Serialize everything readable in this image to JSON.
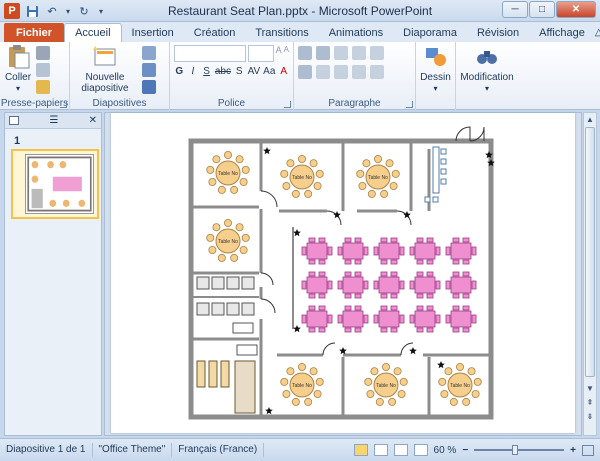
{
  "window": {
    "title": "Restaurant Seat Plan.pptx - Microsoft PowerPoint",
    "app_letter": "P"
  },
  "tabs": [
    {
      "label": "Fichier"
    },
    {
      "label": "Accueil"
    },
    {
      "label": "Insertion"
    },
    {
      "label": "Création"
    },
    {
      "label": "Transitions"
    },
    {
      "label": "Animations"
    },
    {
      "label": "Diaporama"
    },
    {
      "label": "Révision"
    },
    {
      "label": "Affichage"
    }
  ],
  "ribbon": {
    "clipboard": {
      "group_label": "Presse-papiers",
      "paste_label": "Coller"
    },
    "slides": {
      "group_label": "Diapositives",
      "new_slide_label_1": "Nouvelle",
      "new_slide_label_2": "diapositive"
    },
    "font": {
      "group_label": "Police",
      "bold": "G",
      "italic": "I",
      "underline": "S",
      "strike": "abc",
      "shadow": "S",
      "spacing": "AV",
      "case": "Aa",
      "color": "A"
    },
    "paragraph": {
      "group_label": "Paragraphe"
    },
    "drawing": {
      "label": "Dessin"
    },
    "editing": {
      "label": "Modification"
    }
  },
  "slides_pane": {
    "slide_number": "1"
  },
  "slide": {
    "table_label": "Table No",
    "top_tables": 3,
    "bottom_tables": 3,
    "pink_rows": 3,
    "pink_cols": 5
  },
  "statusbar": {
    "slide_info": "Diapositive 1 de 1",
    "theme": "\"Office Theme\"",
    "language": "Français (France)",
    "zoom": "60 %",
    "zoom_fraction": 0.45
  },
  "colors": {
    "file_tab": "#d0532a",
    "table": "#f7cf8c",
    "pink_chair": "#f08fd0",
    "wall": "#8c8c8c"
  }
}
